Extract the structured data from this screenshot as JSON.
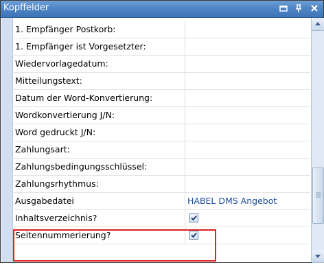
{
  "window": {
    "title": "Kopffelder",
    "icons": [
      "restore-icon",
      "pin-icon",
      "close-icon"
    ]
  },
  "rows": [
    {
      "label": "1. Empfänger Postkorb:",
      "value": ""
    },
    {
      "label": "1. Empfänger ist Vorgesetzter:",
      "value": ""
    },
    {
      "label": "Wiedervorlagedatum:",
      "value": ""
    },
    {
      "label": "Mitteilungstext:",
      "value": ""
    },
    {
      "label": "Datum der Word-Konvertierung:",
      "value": ""
    },
    {
      "label": "Wordkonvertierung J/N:",
      "value": ""
    },
    {
      "label": "Word gedruckt J/N:",
      "value": ""
    },
    {
      "label": "Zahlungsart:",
      "value": ""
    },
    {
      "label": "Zahlungsbedingungsschlüssel:",
      "value": ""
    },
    {
      "label": "Zahlungsrhythmus:",
      "value": ""
    },
    {
      "label": "Ausgabedatei",
      "value": "HABEL DMS Angebot"
    },
    {
      "label": "Inhaltsverzeichnis?",
      "checked": true
    },
    {
      "label": "Seitennummerierung?",
      "checked": true
    }
  ],
  "colors": {
    "titlebar": "#4f86c6",
    "value_text": "#1a4d9c",
    "highlight": "#e02020"
  }
}
